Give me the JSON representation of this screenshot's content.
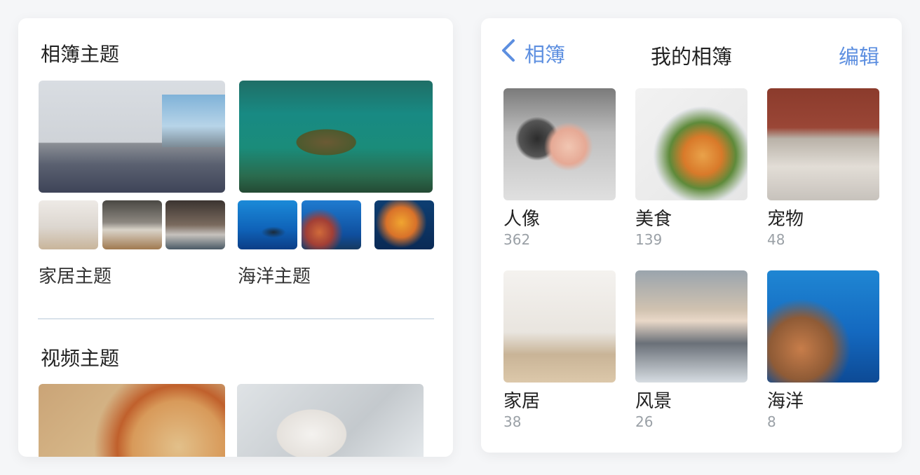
{
  "left": {
    "album_themes_title": "相簿主题",
    "themes": [
      {
        "label": "家居主题",
        "main_image": "living-room-photo",
        "thumbs": [
          "bedroom-photo",
          "bedroom-photo",
          "bedroom-photo"
        ]
      },
      {
        "label": "海洋主题",
        "main_image": "sea-turtle-photo",
        "thumbs": [
          "manta-ray-photo",
          "coral-reef-photo",
          "jellyfish-photo"
        ]
      }
    ],
    "video_themes_title": "视频主题",
    "video_images": [
      "pizza-photo",
      "cake-photo"
    ]
  },
  "right": {
    "nav": {
      "back_label": "相簿",
      "title": "我的相簿",
      "edit_label": "编辑"
    },
    "albums": [
      {
        "name": "人像",
        "count": "362"
      },
      {
        "name": "美食",
        "count": "139"
      },
      {
        "name": "宠物",
        "count": "48"
      },
      {
        "name": "家居",
        "count": "38"
      },
      {
        "name": "风景",
        "count": "26"
      },
      {
        "name": "海洋",
        "count": "8"
      }
    ]
  },
  "colors": {
    "accent": "#5d8fe0",
    "background": "#f5f6f8",
    "card": "#ffffff",
    "count_text": "#9aa0a6"
  }
}
